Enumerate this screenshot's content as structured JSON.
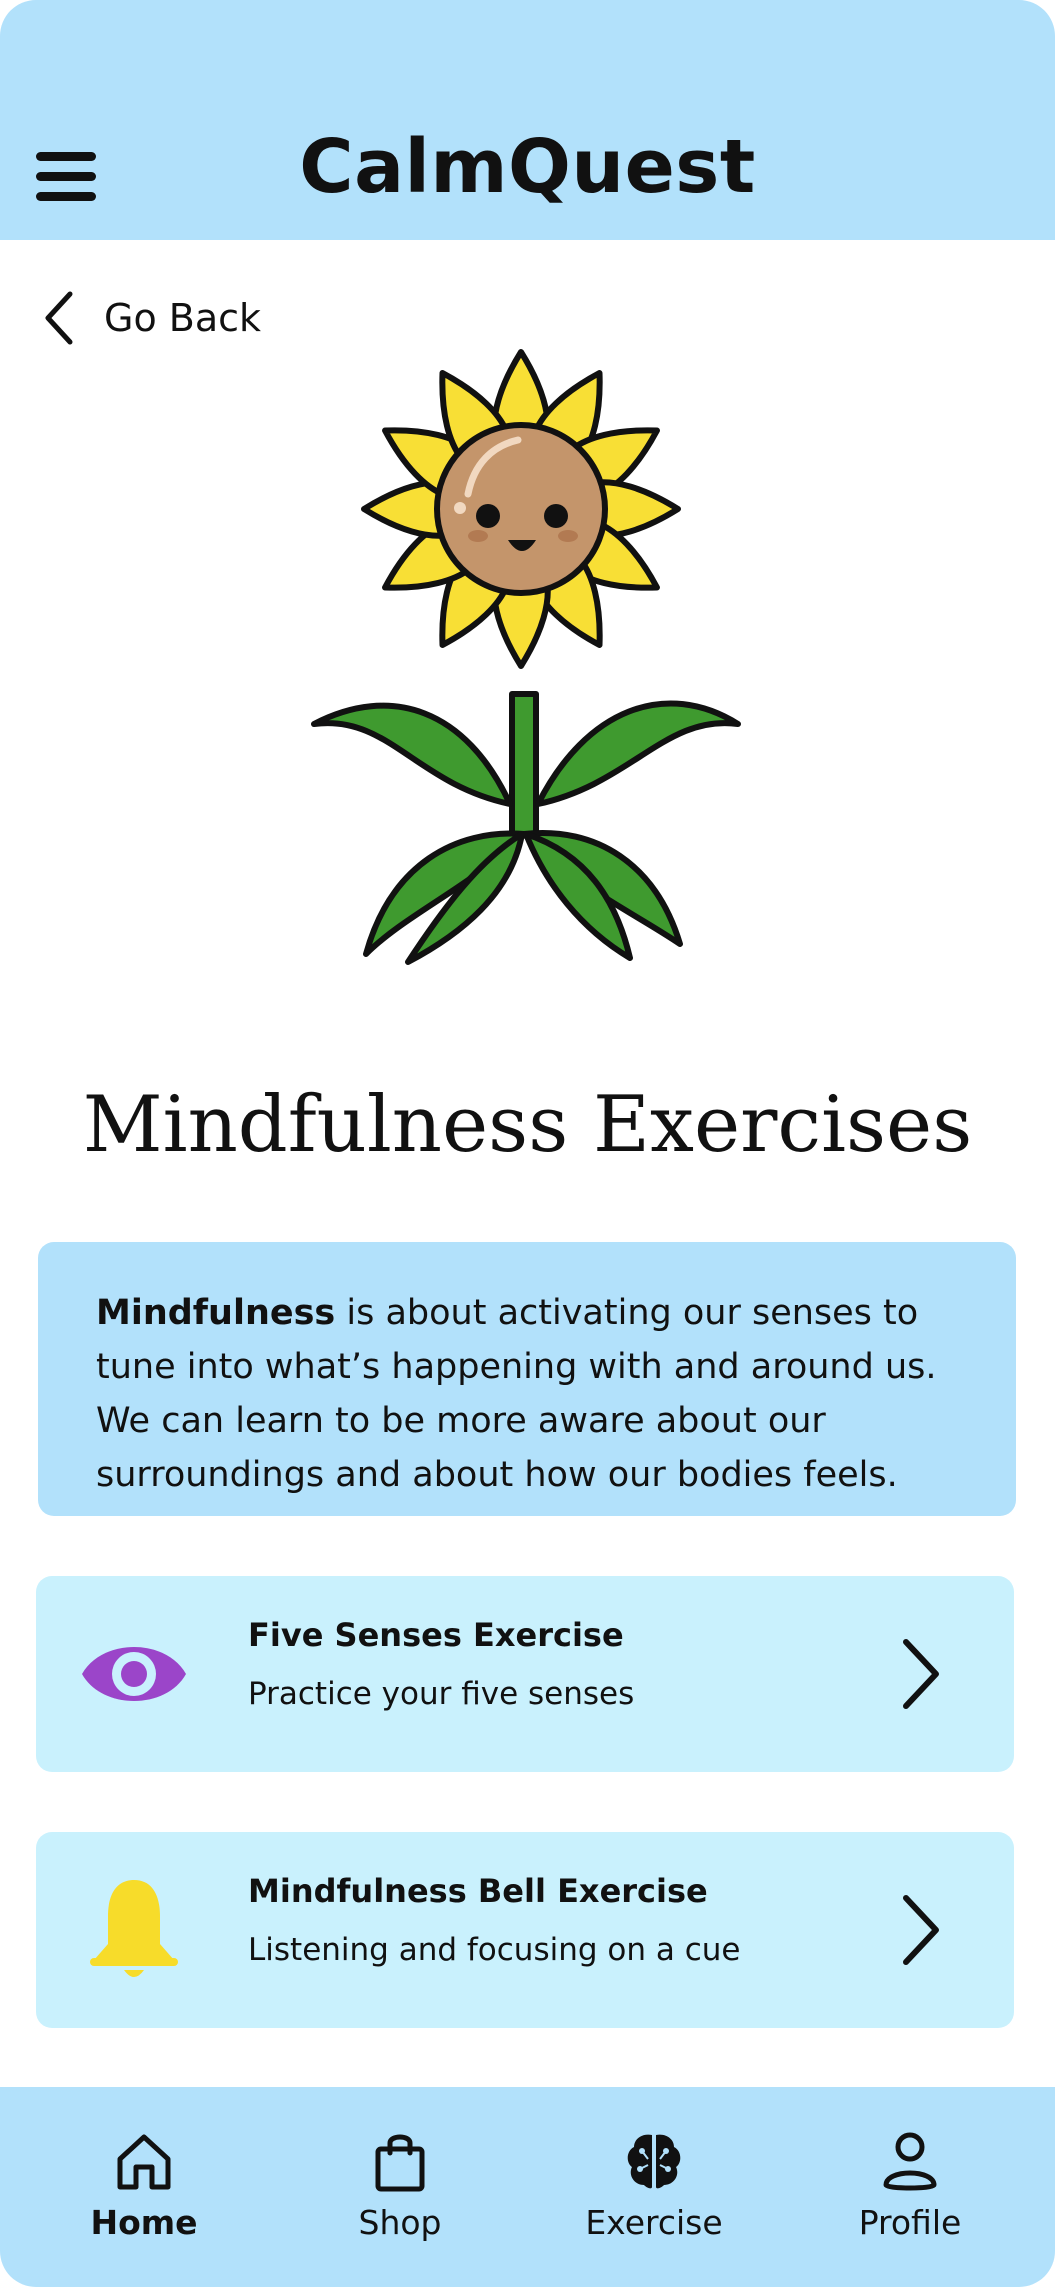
{
  "header": {
    "title": "CalmQuest"
  },
  "nav": {
    "back_label": "Go Back"
  },
  "page": {
    "title": "Mindfulness Exercises"
  },
  "intro": {
    "bold": "Mindfulness",
    "text": " is about activating our senses to tune into what’s happening with and around us. We can learn to be more aware about our surroundings and about how our bodies feels."
  },
  "exercises": [
    {
      "title": "Five Senses Exercise",
      "subtitle": "Practice your five senses",
      "icon": "eye-icon",
      "icon_color": "#9b45c9"
    },
    {
      "title": "Mindfulness Bell Exercise",
      "subtitle": "Listening and focusing on a cue",
      "icon": "bell-icon",
      "icon_color": "#f7dc2a"
    }
  ],
  "tabs": [
    {
      "label": "Home",
      "icon": "home-icon",
      "active": true
    },
    {
      "label": "Shop",
      "icon": "shopping-bag-icon",
      "active": false
    },
    {
      "label": "Exercise",
      "icon": "brain-icon",
      "active": false
    },
    {
      "label": "Profile",
      "icon": "user-icon",
      "active": false
    }
  ],
  "colors": {
    "header_bg": "#b2e1fb",
    "card_bg": "#c9f1fd",
    "petal": "#f8df35",
    "leaf": "#3f9a2f",
    "face": "#c4956b"
  }
}
